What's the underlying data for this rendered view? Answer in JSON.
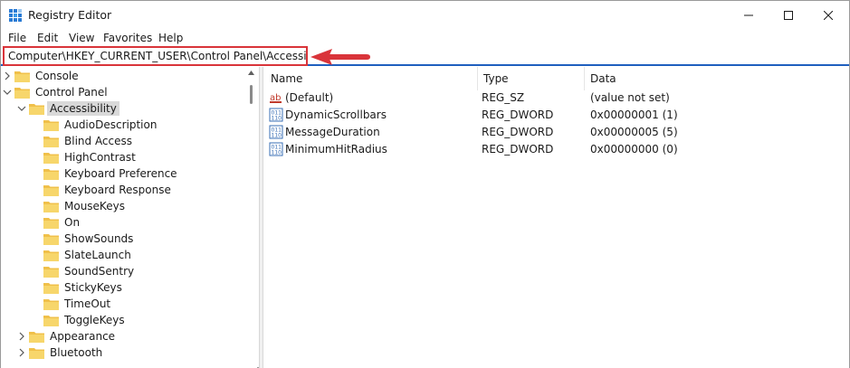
{
  "window": {
    "title": "Registry Editor",
    "app_icon": "registry-editor-icon",
    "controls": [
      "minimize-icon",
      "maximize-icon",
      "close-icon"
    ]
  },
  "menu": [
    "File",
    "Edit",
    "View",
    "Favorites",
    "Help"
  ],
  "address": {
    "path": "Computer\\HKEY_CURRENT_USER\\Control Panel\\Accessibility",
    "highlight_color": "#d9343a"
  },
  "tree": [
    {
      "label": "Console",
      "level": 0,
      "expanded": false,
      "has_children": true
    },
    {
      "label": "Control Panel",
      "level": 0,
      "expanded": true,
      "has_children": true
    },
    {
      "label": "Accessibility",
      "level": 1,
      "expanded": true,
      "has_children": true,
      "selected": true
    },
    {
      "label": "AudioDescription",
      "level": 2,
      "has_children": false
    },
    {
      "label": "Blind Access",
      "level": 2,
      "has_children": false
    },
    {
      "label": "HighContrast",
      "level": 2,
      "has_children": false
    },
    {
      "label": "Keyboard Preference",
      "level": 2,
      "has_children": false
    },
    {
      "label": "Keyboard Response",
      "level": 2,
      "has_children": false
    },
    {
      "label": "MouseKeys",
      "level": 2,
      "has_children": false
    },
    {
      "label": "On",
      "level": 2,
      "has_children": false
    },
    {
      "label": "ShowSounds",
      "level": 2,
      "has_children": false
    },
    {
      "label": "SlateLaunch",
      "level": 2,
      "has_children": false
    },
    {
      "label": "SoundSentry",
      "level": 2,
      "has_children": false
    },
    {
      "label": "StickyKeys",
      "level": 2,
      "has_children": false
    },
    {
      "label": "TimeOut",
      "level": 2,
      "has_children": false
    },
    {
      "label": "ToggleKeys",
      "level": 2,
      "has_children": false
    },
    {
      "label": "Appearance",
      "level": 1,
      "expanded": false,
      "has_children": true
    },
    {
      "label": "Bluetooth",
      "level": 1,
      "expanded": false,
      "has_children": true
    }
  ],
  "columns": {
    "name": "Name",
    "type": "Type",
    "data": "Data"
  },
  "values": [
    {
      "name": "(Default)",
      "type": "REG_SZ",
      "data": "(value not set)",
      "icon": "string-value-icon"
    },
    {
      "name": "DynamicScrollbars",
      "type": "REG_DWORD",
      "data": "0x00000001 (1)",
      "icon": "binary-value-icon"
    },
    {
      "name": "MessageDuration",
      "type": "REG_DWORD",
      "data": "0x00000005 (5)",
      "icon": "binary-value-icon"
    },
    {
      "name": "MinimumHitRadius",
      "type": "REG_DWORD",
      "data": "0x00000000 (0)",
      "icon": "binary-value-icon"
    }
  ]
}
